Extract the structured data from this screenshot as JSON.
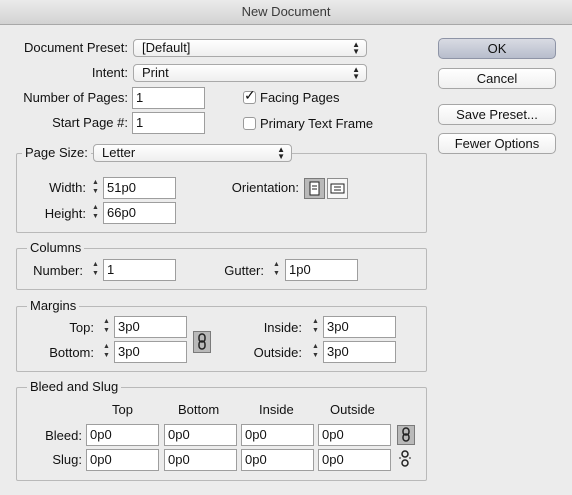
{
  "window": {
    "title": "New Document"
  },
  "document_preset": {
    "label": "Document Preset:",
    "value": "[Default]"
  },
  "intent": {
    "label": "Intent:",
    "value": "Print"
  },
  "number_of_pages": {
    "label": "Number of Pages:",
    "value": "1"
  },
  "start_page": {
    "label": "Start Page #:",
    "value": "1"
  },
  "facing_pages": {
    "label": "Facing Pages",
    "checked": true
  },
  "primary_text_frame": {
    "label": "Primary Text Frame",
    "checked": false
  },
  "buttons": {
    "ok": "OK",
    "cancel": "Cancel",
    "save_preset": "Save Preset...",
    "fewer_options": "Fewer Options"
  },
  "page_size": {
    "label": "Page Size:",
    "value": "Letter",
    "width_label": "Width:",
    "width": "51p0",
    "height_label": "Height:",
    "height": "66p0",
    "orientation_label": "Orientation:",
    "orientation_selected": "portrait"
  },
  "columns": {
    "legend": "Columns",
    "number_label": "Number:",
    "number": "1",
    "gutter_label": "Gutter:",
    "gutter": "1p0"
  },
  "margins": {
    "legend": "Margins",
    "top_label": "Top:",
    "top": "3p0",
    "bottom_label": "Bottom:",
    "bottom": "3p0",
    "inside_label": "Inside:",
    "inside": "3p0",
    "outside_label": "Outside:",
    "outside": "3p0"
  },
  "bleed_slug": {
    "legend": "Bleed and Slug",
    "headers": [
      "Top",
      "Bottom",
      "Inside",
      "Outside"
    ],
    "bleed_label": "Bleed:",
    "bleed": [
      "0p0",
      "0p0",
      "0p0",
      "0p0"
    ],
    "slug_label": "Slug:",
    "slug": [
      "0p0",
      "0p0",
      "0p0",
      "0p0"
    ]
  }
}
